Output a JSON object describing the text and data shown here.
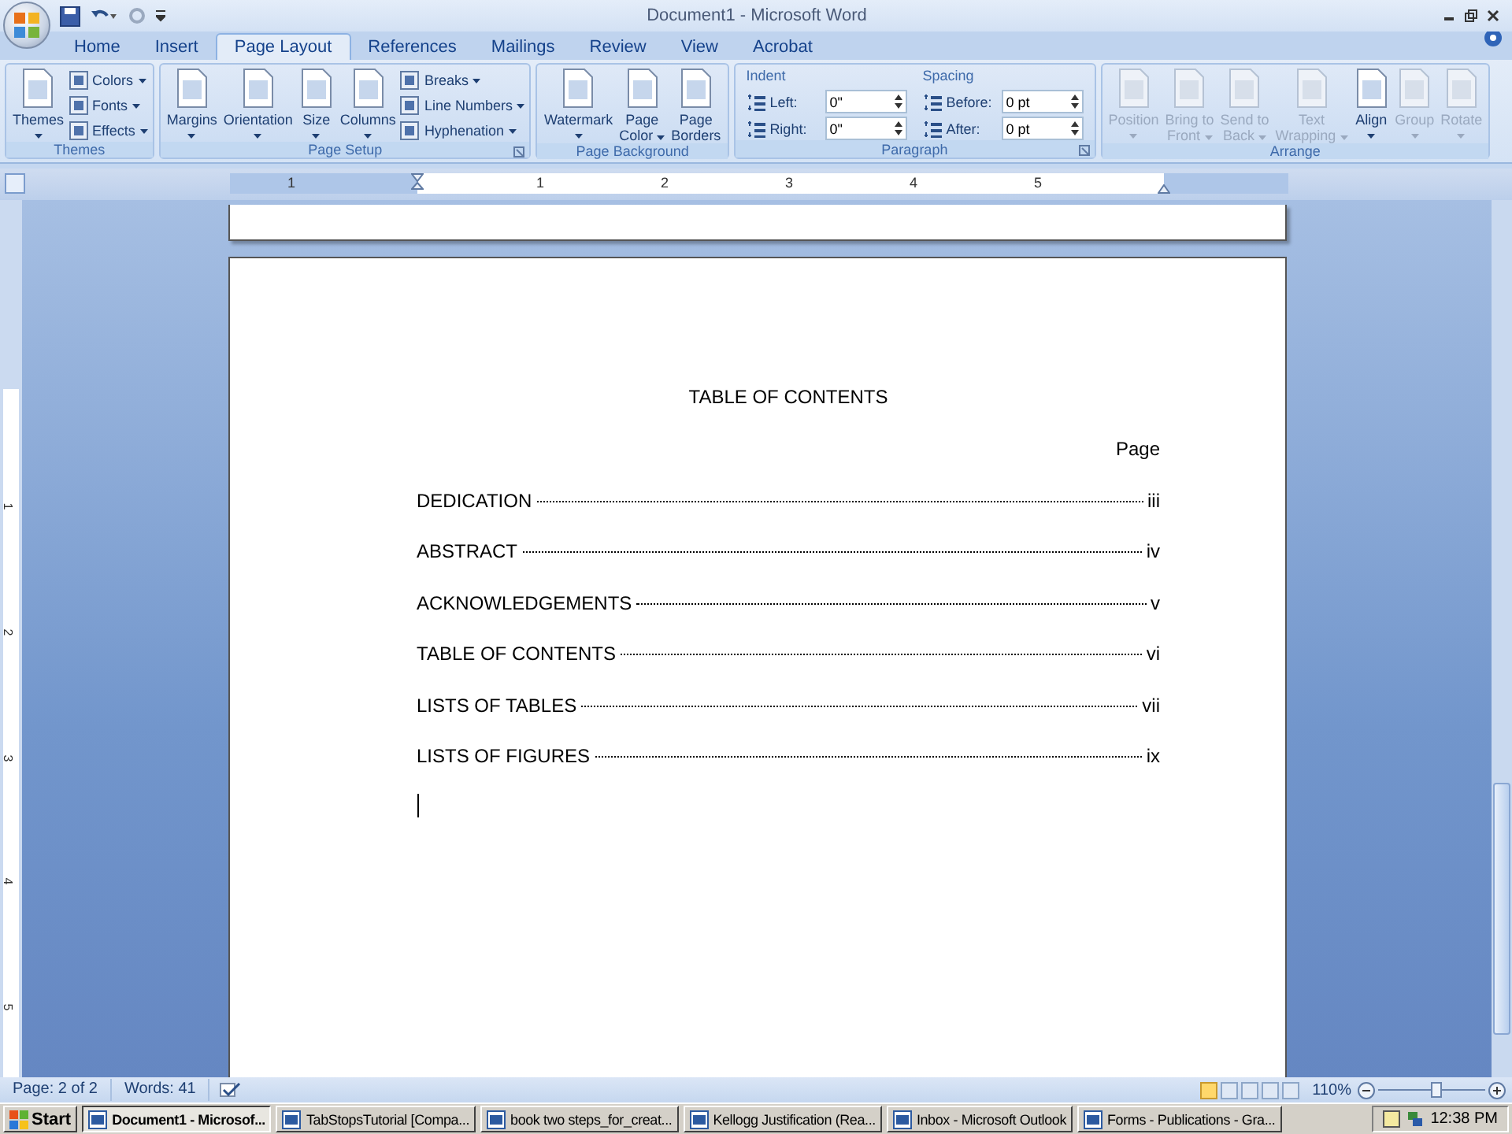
{
  "window": {
    "title": "Document1 - Microsoft Word"
  },
  "tabs": [
    {
      "label": "Home",
      "selected": false
    },
    {
      "label": "Insert",
      "selected": false
    },
    {
      "label": "Page Layout",
      "selected": true
    },
    {
      "label": "References",
      "selected": false
    },
    {
      "label": "Mailings",
      "selected": false
    },
    {
      "label": "Review",
      "selected": false
    },
    {
      "label": "View",
      "selected": false
    },
    {
      "label": "Acrobat",
      "selected": false
    }
  ],
  "ribbon_groups": [
    {
      "label": "Themes",
      "launcher": false,
      "columns": [
        {
          "kind": "large",
          "lines": [
            "Themes"
          ],
          "dropdown": true,
          "disabled": false
        },
        {
          "kind": "stack",
          "items": [
            {
              "label": "Colors",
              "dropdown": true
            },
            {
              "label": "Fonts",
              "dropdown": true
            },
            {
              "label": "Effects",
              "dropdown": true
            }
          ]
        }
      ]
    },
    {
      "label": "Page Setup",
      "launcher": true,
      "columns": [
        {
          "kind": "large",
          "lines": [
            "Margins"
          ],
          "dropdown": true,
          "disabled": false
        },
        {
          "kind": "large",
          "lines": [
            "Orientation"
          ],
          "dropdown": true,
          "disabled": false
        },
        {
          "kind": "large",
          "lines": [
            "Size"
          ],
          "dropdown": true,
          "disabled": false
        },
        {
          "kind": "large",
          "lines": [
            "Columns"
          ],
          "dropdown": true,
          "disabled": false
        },
        {
          "kind": "stack",
          "items": [
            {
              "label": "Breaks",
              "dropdown": true
            },
            {
              "label": "Line Numbers",
              "dropdown": true
            },
            {
              "label": "Hyphenation",
              "dropdown": true
            }
          ]
        }
      ]
    },
    {
      "label": "Page Background",
      "launcher": false,
      "columns": [
        {
          "kind": "large",
          "lines": [
            "Watermark"
          ],
          "dropdown": true,
          "disabled": false
        },
        {
          "kind": "large",
          "lines": [
            "Page",
            "Color"
          ],
          "dropdown": true,
          "disabled": false
        },
        {
          "kind": "large",
          "lines": [
            "Page",
            "Borders"
          ],
          "dropdown": false,
          "disabled": false
        }
      ]
    },
    {
      "label": "Paragraph",
      "launcher": true,
      "columns": [
        {
          "kind": "spins",
          "heading": "Indent",
          "fields": [
            {
              "label": "Left:",
              "value": "0\""
            },
            {
              "label": "Right:",
              "value": "0\""
            }
          ]
        },
        {
          "kind": "spins",
          "heading": "Spacing",
          "fields": [
            {
              "label": "Before:",
              "value": "0 pt"
            },
            {
              "label": "After:",
              "value": "0 pt"
            }
          ]
        }
      ]
    },
    {
      "label": "Arrange",
      "launcher": false,
      "columns": [
        {
          "kind": "large",
          "lines": [
            "Position"
          ],
          "dropdown": true,
          "disabled": true
        },
        {
          "kind": "large",
          "lines": [
            "Bring to",
            "Front"
          ],
          "dropdown": true,
          "disabled": true
        },
        {
          "kind": "large",
          "lines": [
            "Send to",
            "Back"
          ],
          "dropdown": true,
          "disabled": true
        },
        {
          "kind": "large",
          "lines": [
            "Text",
            "Wrapping"
          ],
          "dropdown": true,
          "disabled": true
        },
        {
          "kind": "large",
          "lines": [
            "Align"
          ],
          "dropdown": true,
          "disabled": false
        },
        {
          "kind": "large",
          "lines": [
            "Group"
          ],
          "dropdown": true,
          "disabled": true
        },
        {
          "kind": "large",
          "lines": [
            "Rotate"
          ],
          "dropdown": true,
          "disabled": true
        }
      ]
    }
  ],
  "ruler": {
    "numbers": [
      "1",
      "1",
      "2",
      "3",
      "4",
      "5"
    ]
  },
  "vertical_ruler": {
    "numbers": [
      "1",
      "2",
      "3",
      "4",
      "5"
    ]
  },
  "document": {
    "title": "TABLE OF CONTENTS",
    "page_label": "Page",
    "entries": [
      {
        "title": "DEDICATION",
        "page": "iii"
      },
      {
        "title": "ABSTRACT",
        "page": "iv"
      },
      {
        "title": "ACKNOWLEDGEMENTS",
        "page": "v"
      },
      {
        "title": "TABLE OF CONTENTS",
        "page": "vi"
      },
      {
        "title": "LISTS OF TABLES",
        "page": "vii"
      },
      {
        "title": "LISTS OF FIGURES",
        "page": "ix"
      }
    ]
  },
  "status_bar": {
    "page": "Page: 2 of 2",
    "words": "Words: 41",
    "views": [
      {
        "selected": true
      },
      {
        "selected": false
      },
      {
        "selected": false
      },
      {
        "selected": false
      },
      {
        "selected": false
      }
    ],
    "zoom": "110%",
    "zoom_slider": {
      "level": 0.55
    }
  },
  "taskbar": {
    "start": "Start",
    "tasks": [
      {
        "label": "Document1 - Microsof...",
        "selected": true
      },
      {
        "label": "TabStopsTutorial [Compa...",
        "selected": false
      },
      {
        "label": "book two steps_for_creat...",
        "selected": false
      },
      {
        "label": "Kellogg Justification (Rea...",
        "selected": false
      },
      {
        "label": "Inbox - Microsoft Outlook",
        "selected": false
      },
      {
        "label": "Forms - Publications - Gra...",
        "selected": false
      }
    ],
    "clock": "12:38 PM"
  }
}
